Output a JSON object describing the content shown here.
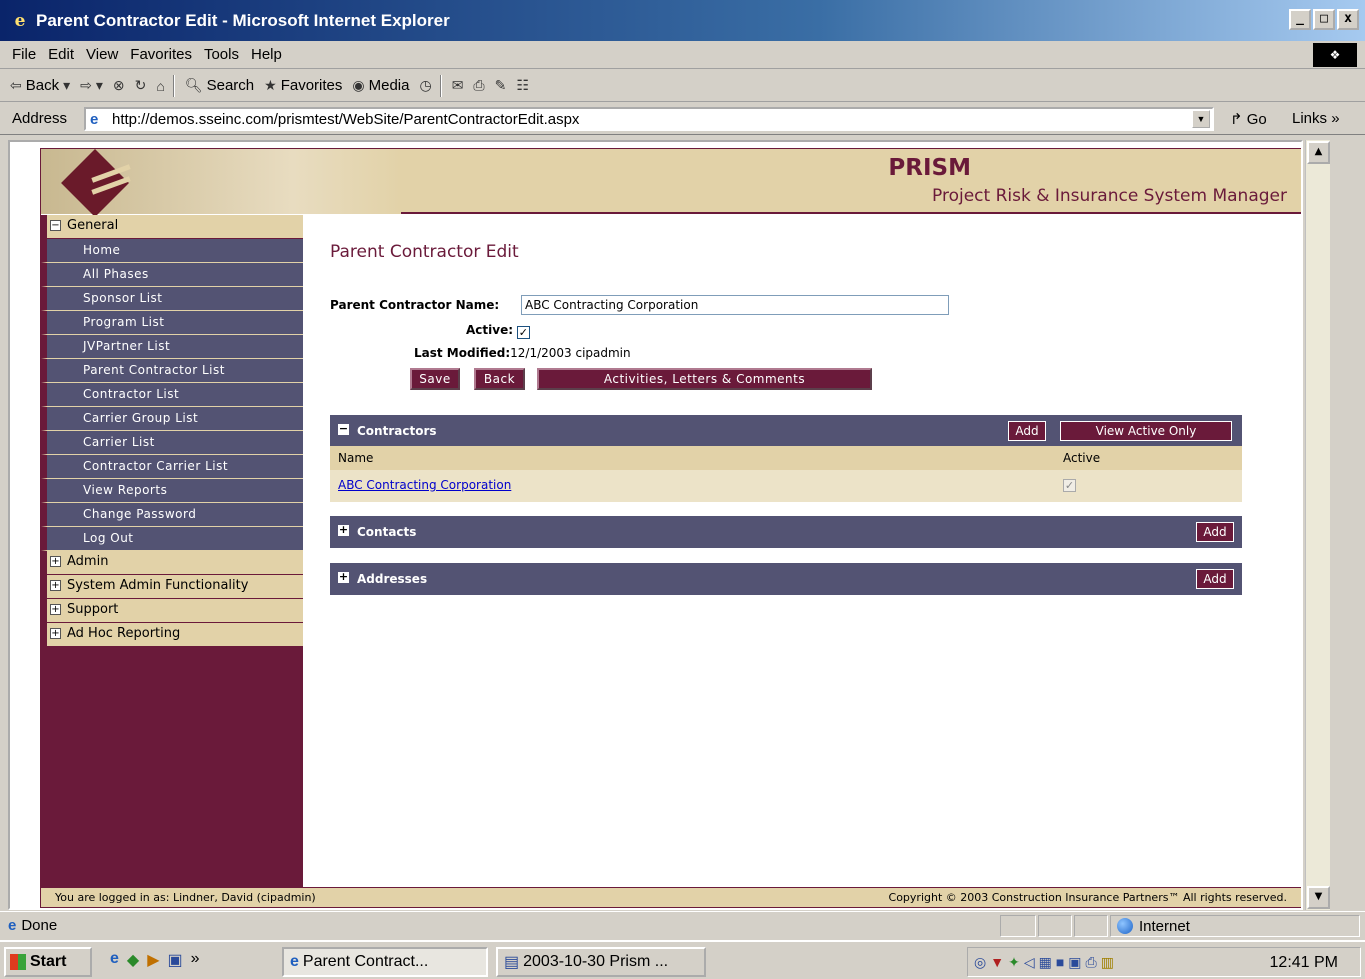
{
  "window": {
    "title": "Parent Contractor Edit - Microsoft Internet Explorer",
    "controls": [
      "_",
      "□",
      "x"
    ]
  },
  "menu": [
    "File",
    "Edit",
    "View",
    "Favorites",
    "Tools",
    "Help"
  ],
  "toolbar": {
    "back": "Back",
    "search": "Search",
    "favorites": "Favorites",
    "media": "Media"
  },
  "address": {
    "label": "Address",
    "url": "http://demos.sseinc.com/prismtest/WebSite/ParentContractorEdit.aspx",
    "go": "Go",
    "links": "Links"
  },
  "header": {
    "brand": "PRISM",
    "subtitle": "Project Risk & Insurance System Manager"
  },
  "sidebar": {
    "general": "General",
    "items": [
      "Home",
      "All Phases",
      "Sponsor List",
      "Program List",
      "JVPartner List",
      "Parent Contractor List",
      "Contractor List",
      "Carrier Group List",
      "Carrier List",
      "Contractor Carrier List",
      "View Reports",
      "Change Password",
      "Log Out"
    ],
    "groups": [
      "Admin",
      "System Admin Functionality",
      "Support",
      "Ad Hoc Reporting"
    ]
  },
  "page": {
    "title": "Parent Contractor Edit",
    "name_label": "Parent Contractor Name:",
    "name_value": "ABC Contracting Corporation",
    "active_label": "Active:",
    "active_checked": true,
    "modified_label": "Last Modified:",
    "modified_value": "12/1/2003 cipadmin",
    "buttons": {
      "save": "Save",
      "back": "Back",
      "activities": "Activities, Letters & Comments"
    }
  },
  "contractors": {
    "title": "Contractors",
    "add": "Add",
    "view_active": "View Active Only",
    "columns": [
      "Name",
      "Active"
    ],
    "rows": [
      {
        "name": "ABC Contracting Corporation",
        "active": true
      }
    ]
  },
  "contacts": {
    "title": "Contacts",
    "add": "Add"
  },
  "addresses": {
    "title": "Addresses",
    "add": "Add"
  },
  "footer": {
    "logged_in": "You are logged in as: Lindner, David (cipadmin)",
    "copyright": "Copyright © 2003 Construction Insurance Partners™ All rights reserved."
  },
  "statusbar": {
    "status": "Done",
    "zone": "Internet"
  },
  "taskbar": {
    "start": "Start",
    "tasks": [
      "Parent Contract...",
      "2003-10-30 Prism ..."
    ],
    "clock": "12:41 PM"
  },
  "colors": {
    "maroon": "#6a1a3a",
    "slate": "#535373",
    "tan": "#e2d2a8"
  }
}
